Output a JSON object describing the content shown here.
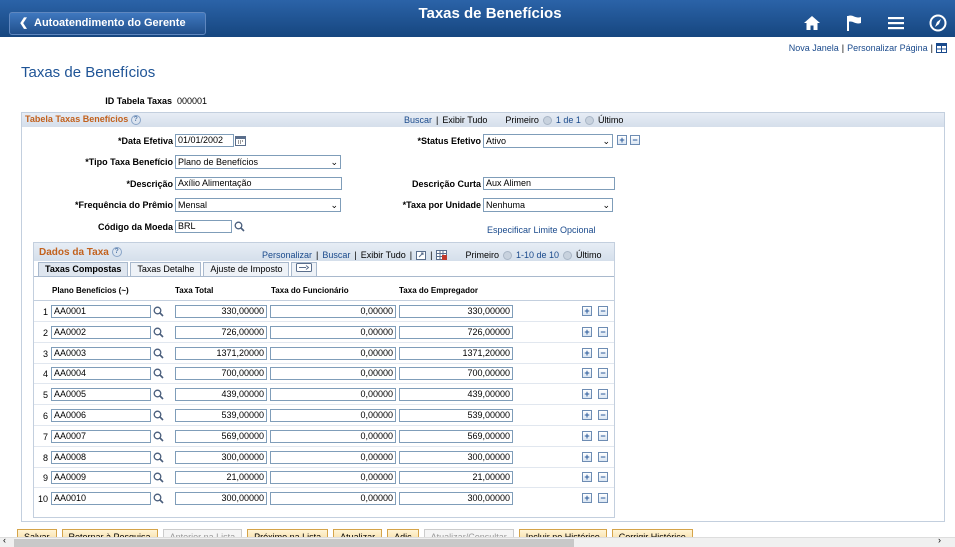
{
  "header": {
    "back_label": "Autoatendimento do Gerente",
    "title": "Taxas de Benefícios"
  },
  "toplinks": {
    "new_window": "Nova Janela",
    "personalize": "Personalizar Página",
    "sep": "|"
  },
  "page_title": "Taxas de Benefícios",
  "id_label": "ID Tabela Taxas",
  "id_value": "000001",
  "group1": {
    "title": "Tabela Taxas Benefícios",
    "find": "Buscar",
    "view_all": "Exibir Tudo",
    "first": "Primeiro",
    "pos": "1 de 1",
    "last": "Último",
    "sep": "|"
  },
  "fields": {
    "eff_date_label": "*Data Efetiva",
    "eff_date": "01/01/2002",
    "eff_status_label": "*Status Efetivo",
    "eff_status": "Ativo",
    "rate_type_label": "*Tipo Taxa Benefício",
    "rate_type": "Plano de Benefícios",
    "descr_label": "*Descrição",
    "descr": "Axílio Alimentação",
    "short_descr_label": "Descrição Curta",
    "short_descr": "Aux Alimen",
    "freq_label": "*Frequência do Prêmio",
    "freq": "Mensal",
    "rate_unit_label": "*Taxa por Unidade",
    "rate_unit": "Nenhuma",
    "currency_label": "Código da Moeda",
    "currency": "BRL",
    "optional_limit": "Especificar Limite Opcional"
  },
  "group2": {
    "title": "Dados da Taxa",
    "personalize": "Personalizar",
    "find": "Buscar",
    "view_all": "Exibir Tudo",
    "first": "Primeiro",
    "pos": "1-10 de 10",
    "last": "Último",
    "sep": "|",
    "tabs": [
      "Taxas Compostas",
      "Taxas Detalhe",
      "Ajuste de Imposto"
    ],
    "cols": [
      "Plano Benefícios (~)",
      "Taxa Total",
      "Taxa do Funcionário",
      "Taxa do Empregador"
    ],
    "rows": [
      {
        "n": "1",
        "plan": "AA0001",
        "total": "330,00000",
        "emp": "0,00000",
        "er": "330,00000"
      },
      {
        "n": "2",
        "plan": "AA0002",
        "total": "726,00000",
        "emp": "0,00000",
        "er": "726,00000"
      },
      {
        "n": "3",
        "plan": "AA0003",
        "total": "1371,20000",
        "emp": "0,00000",
        "er": "1371,20000"
      },
      {
        "n": "4",
        "plan": "AA0004",
        "total": "700,00000",
        "emp": "0,00000",
        "er": "700,00000"
      },
      {
        "n": "5",
        "plan": "AA0005",
        "total": "439,00000",
        "emp": "0,00000",
        "er": "439,00000"
      },
      {
        "n": "6",
        "plan": "AA0006",
        "total": "539,00000",
        "emp": "0,00000",
        "er": "539,00000"
      },
      {
        "n": "7",
        "plan": "AA0007",
        "total": "569,00000",
        "emp": "0,00000",
        "er": "569,00000"
      },
      {
        "n": "8",
        "plan": "AA0008",
        "total": "300,00000",
        "emp": "0,00000",
        "er": "300,00000"
      },
      {
        "n": "9",
        "plan": "AA0009",
        "total": "21,00000",
        "emp": "0,00000",
        "er": "21,00000"
      },
      {
        "n": "10",
        "plan": "AA0010",
        "total": "300,00000",
        "emp": "0,00000",
        "er": "300,00000"
      }
    ]
  },
  "buttons": [
    "Salvar",
    "Retornar à Pesquisa",
    "Anterior na Lista",
    "Próximo na Lista",
    "Atualizar",
    "Adic",
    "Atualizar/Consultar",
    "Incluir no Histórico",
    "Corrigir Histórico"
  ],
  "plus": "+",
  "minus": "−",
  "help": "?"
}
